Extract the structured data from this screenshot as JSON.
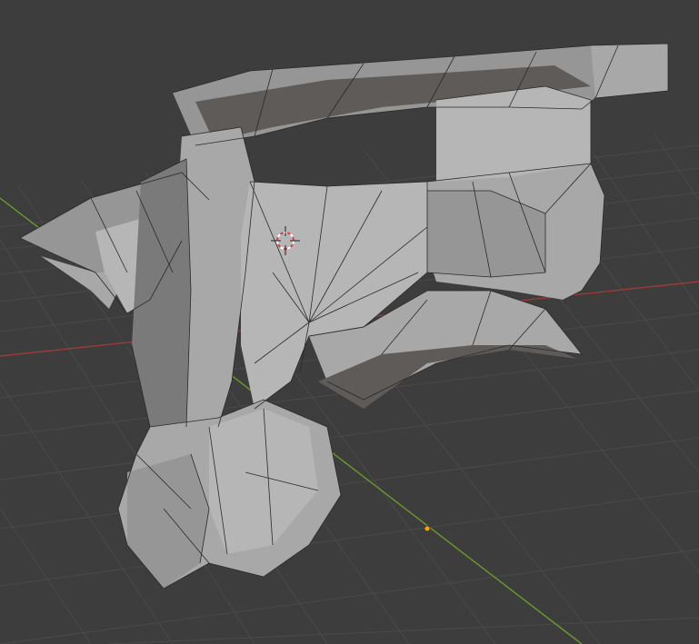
{
  "viewport": {
    "mode": "3D Viewport",
    "shading": "solid-wireframe"
  },
  "colors": {
    "background": "#3d3d3d",
    "grid": "#4a4a4a",
    "x_axis": "#9c3a3a",
    "y_axis": "#6a9a2a",
    "mesh": "#a8a8a8",
    "wire": "#2a2a2a",
    "origin": "#ffa500",
    "cursor_red": "#e04040",
    "cursor_white": "#ffffff"
  },
  "icons": {
    "cursor": "3d-cursor-icon",
    "origin": "object-origin-icon"
  }
}
